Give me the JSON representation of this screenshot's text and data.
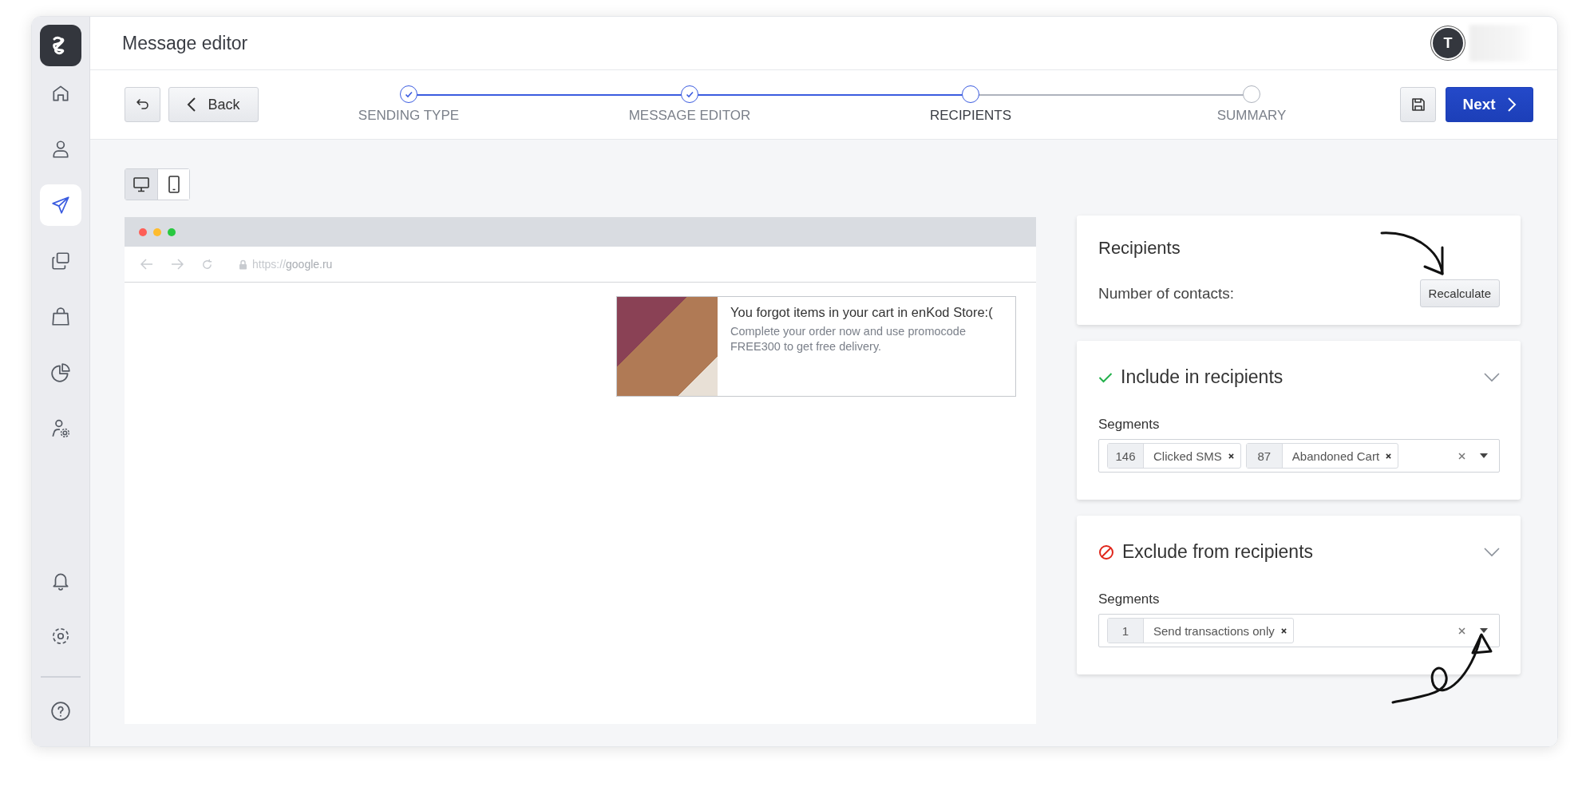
{
  "sidebar": {
    "items": [
      {
        "kind": "home",
        "selected": false
      },
      {
        "kind": "person",
        "selected": false
      },
      {
        "kind": "send",
        "selected": true
      },
      {
        "kind": "copies",
        "selected": false
      },
      {
        "kind": "bag",
        "selected": false
      },
      {
        "kind": "pie",
        "selected": false
      },
      {
        "kind": "person-gear",
        "selected": false
      }
    ],
    "bottom_items": [
      {
        "kind": "bell"
      },
      {
        "kind": "gear"
      },
      {
        "kind": "help"
      }
    ]
  },
  "header": {
    "title": "Message editor",
    "avatar_initial": "T"
  },
  "toolbar": {
    "back_label": "Back",
    "next_label": "Next"
  },
  "steps": [
    {
      "label": "SENDING TYPE",
      "done": true,
      "selected": false
    },
    {
      "label": "MESSAGE EDITOR",
      "done": true,
      "selected": false
    },
    {
      "label": "RECIPIENTS",
      "done": false,
      "selected": true
    },
    {
      "label": "SUMMARY",
      "done": false,
      "selected": false
    }
  ],
  "device_toggle": [
    {
      "kind": "desktop",
      "selected": true
    },
    {
      "kind": "mobile",
      "selected": false
    }
  ],
  "preview": {
    "url_scheme": "https://",
    "url_host": "google.ru",
    "popup": {
      "title": "You forgot items in your cart in enKod Store:(",
      "body": "Complete your order now and use promocode FREE300 to get free delivery."
    }
  },
  "recipients": {
    "title": "Recipients",
    "contacts_label": "Number of contacts:",
    "recalculate_label": "Recalculate"
  },
  "filters": [
    {
      "kind": "include",
      "title": "Include in recipients",
      "segments_label": "Segments",
      "segments": [
        {
          "count": "146",
          "name": "Clicked SMS"
        },
        {
          "count": "87",
          "name": "Abandoned Cart"
        }
      ]
    },
    {
      "kind": "exclude",
      "title": "Exclude from recipients",
      "segments_label": "Segments",
      "segments": [
        {
          "count": "1",
          "name": "Send transactions only"
        }
      ]
    }
  ]
}
